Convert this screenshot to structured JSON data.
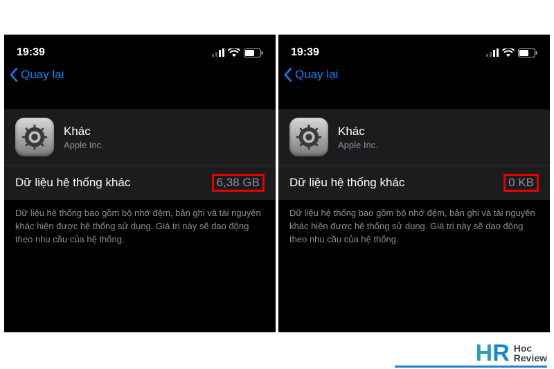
{
  "left": {
    "status": {
      "time": "19:39"
    },
    "nav": {
      "back_label": "Quay lại"
    },
    "app": {
      "name": "Khác",
      "vendor": "Apple Inc."
    },
    "row": {
      "label": "Dữ liệu hệ thống khác",
      "value": "6,38 GB"
    },
    "desc": "Dữ liệu hệ thống bao gồm bộ nhớ đệm, bản ghi và tài nguyên khác hiện được hệ thống sử dụng. Giá trị này sẽ dao động theo nhu cầu của hệ thống."
  },
  "right": {
    "status": {
      "time": "19:39"
    },
    "nav": {
      "back_label": "Quay lại"
    },
    "app": {
      "name": "Khác",
      "vendor": "Apple Inc."
    },
    "row": {
      "label": "Dữ liệu hệ thống khác",
      "value": "0 KB"
    },
    "desc": "Dữ liệu hệ thống bao gồm bộ nhớ đệm, bản ghi và tài nguyên khác hiện được hệ thống sử dụng. Giá trị này sẽ dao động theo nhu cầu của hệ thống."
  },
  "watermark": {
    "brand_left": "H",
    "brand_right": "R",
    "line1": "Hoc",
    "line2": "Review"
  }
}
